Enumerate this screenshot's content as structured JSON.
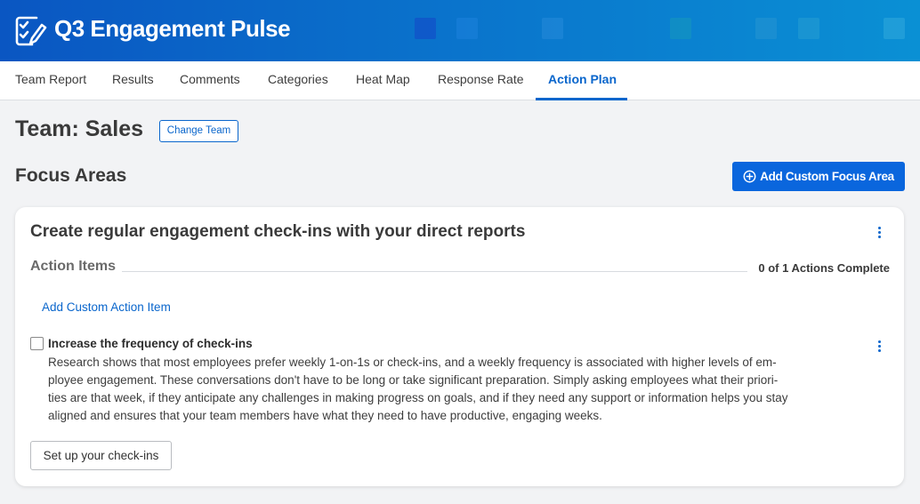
{
  "header": {
    "title": "Q3 Engagement Pulse",
    "icon": "clipboard-check-icon",
    "gradient": [
      "#0a56c2",
      "#0a90d4"
    ]
  },
  "tabs": [
    {
      "label": "Team Report",
      "active": false
    },
    {
      "label": "Results",
      "active": false
    },
    {
      "label": "Comments",
      "active": false
    },
    {
      "label": "Categories",
      "active": false
    },
    {
      "label": "Heat Map",
      "active": false
    },
    {
      "label": "Response Rate",
      "active": false
    },
    {
      "label": "Action Plan",
      "active": true
    }
  ],
  "team": {
    "title": "Team: Sales",
    "change_label": "Change Team"
  },
  "focus": {
    "title": "Focus Areas",
    "add_label": "Add Custom Focus Area"
  },
  "card": {
    "title": "Create regular engagement check-ins with your direct reports",
    "action_items_label": "Action Items",
    "progress_text": "0 of 1 Actions Complete",
    "add_action_label": "Add Custom Action Item",
    "item": {
      "title": "Increase the frequency of check-ins",
      "checked": false,
      "desc_lines": [
        "Research shows that most employees prefer weekly 1-on-1s or check-ins, and a weekly frequency is associated with higher levels of em-",
        "ployee engagement. These conversations don't have to be long or take significant preparation. Simply asking employees what their priori-",
        "ties are that week, if they anticipate any challenges in making progress on goals, and if they need any support or information helps you stay",
        "aligned and ensures that your team members have what they need to have productive, engaging weeks."
      ],
      "button_label": "Set up your check-ins"
    }
  },
  "colors": {
    "accent": "#0a66cc",
    "primary_button": "#0a66dd"
  }
}
